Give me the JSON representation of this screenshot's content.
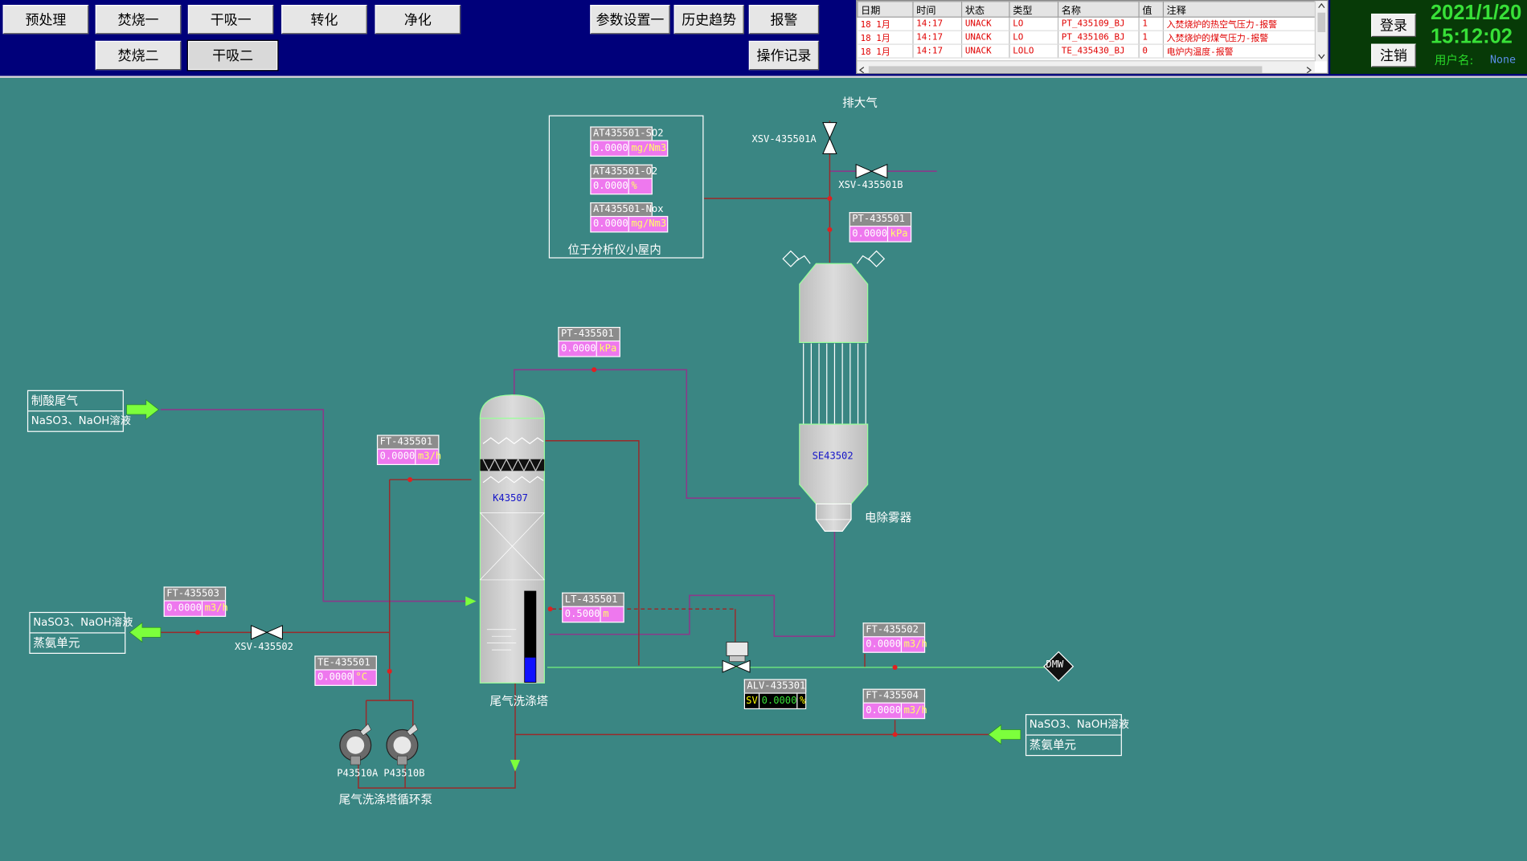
{
  "nav": {
    "pretreat": "预处理",
    "burn1": "焚烧一",
    "dry1": "干吸一",
    "convert": "转化",
    "purify": "净化",
    "burn2": "焚烧二",
    "dry2": "干吸二",
    "params": "参数设置一",
    "history": "历史趋势",
    "alarm": "报警",
    "oplog": "操作记录"
  },
  "alarms": {
    "headers": [
      "日期",
      "时间",
      "状态",
      "类型",
      "名称",
      "值",
      "注释"
    ],
    "rows": [
      [
        "18 1月",
        "14:17",
        "UNACK",
        "LO",
        "PT_435109_BJ",
        "1",
        "入焚烧炉的热空气压力-报警"
      ],
      [
        "18 1月",
        "14:17",
        "UNACK",
        "LO",
        "PT_435106_BJ",
        "1",
        "入焚烧炉的煤气压力-报警"
      ],
      [
        "18 1月",
        "14:17",
        "UNACK",
        "LOLO",
        "TE_435430_BJ",
        "0",
        "电炉内温度-报警"
      ]
    ]
  },
  "header": {
    "login": "登录",
    "logout": "注销",
    "date": "2021/1/20",
    "time": "15:12:02",
    "user_label": "用户名:",
    "user_value": "None"
  },
  "analyzer": {
    "so2": {
      "name": "AT435501-SO2",
      "value": "0.0000",
      "unit": "mg/Nm3"
    },
    "o2": {
      "name": "AT435501-O2",
      "value": "0.0000",
      "unit": "%"
    },
    "nox": {
      "name": "AT435501-Nox",
      "value": "0.0000",
      "unit": "mg/Nm3"
    },
    "caption": "位于分析仪小屋内"
  },
  "instruments": {
    "pt_top": {
      "name": "PT-435501",
      "value": "0.0000",
      "unit": "kPa"
    },
    "pt_mid": {
      "name": "PT-435501",
      "value": "0.0000",
      "unit": "kPa"
    },
    "ft_435501": {
      "name": "FT-435501",
      "value": "0.0000",
      "unit": "m3/h"
    },
    "ft_435503": {
      "name": "FT-435503",
      "value": "0.0000",
      "unit": "m3/h"
    },
    "lt_435501": {
      "name": "LT-435501",
      "value": "0.5000",
      "unit": "m"
    },
    "ft_435502": {
      "name": "FT-435502",
      "value": "0.0000",
      "unit": "m3/h"
    },
    "te_435501": {
      "name": "TE-435501",
      "value": "0.0000",
      "unit": "°C"
    },
    "ft_435504": {
      "name": "FT-435504",
      "value": "0.0000",
      "unit": "m3/h"
    },
    "alv_435301": {
      "name": "ALV-435301",
      "sv": "SV",
      "value": "0.0000",
      "unit": "%"
    }
  },
  "labels": {
    "vent": "排大气",
    "xsv_a": "XSV-435501A",
    "xsv_b": "XSV-435501B",
    "xsv_502": "XSV-435502",
    "tower_tag": "K43507",
    "tower_name": "尾气洗涤塔",
    "esp_tag": "SE43502",
    "esp_name": "电除雾器",
    "pump_a": "P43510A",
    "pump_b": "P43510B",
    "pumps_name": "尾气洗涤塔循环泵",
    "dmw": "DMW"
  },
  "streams": {
    "inlet_gas": {
      "line1": "制酸尾气",
      "line2": "NaSO3、NaOH溶液"
    },
    "outlet_left": {
      "line1": "NaSO3、NaOH溶液",
      "line2": "蒸氨单元"
    },
    "inlet_right": {
      "line1": "NaSO3、NaOH溶液",
      "line2": "蒸氨单元"
    }
  },
  "tower_level_fraction": 0.27,
  "colors": {
    "background": "#3a8683",
    "topbar": "#00007a",
    "tag_value": "#ee78ee",
    "pipe_purple": "#8a3a8a",
    "pipe_red": "#9a2a2a",
    "pipe_green": "#7cff7c",
    "alarm_text": "#e00000",
    "clock": "#38e038"
  }
}
